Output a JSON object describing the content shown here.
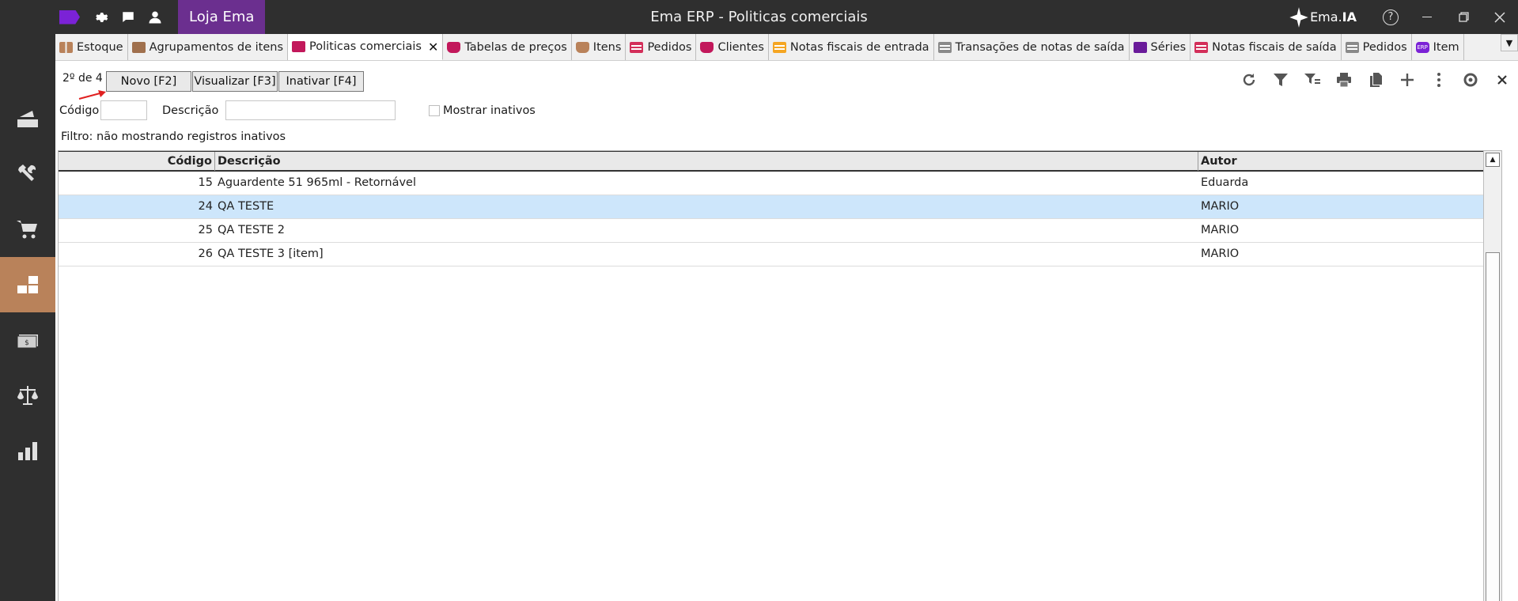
{
  "titlebar": {
    "store": "Loja Ema",
    "title": "Ema ERP - Politicas comerciais",
    "brand_prefix": "Ema.",
    "brand_suffix": "IA",
    "help": "?"
  },
  "tabs": [
    {
      "label": "Estoque",
      "icon": "blocks-icon",
      "color": "#b9825a"
    },
    {
      "label": "Agrupamentos de itens",
      "icon": "folder-icon",
      "color": "#a0704d"
    },
    {
      "label": "Politicas comerciais",
      "icon": "folder-icon",
      "color": "#c2185b",
      "active": true
    },
    {
      "label": "Tabelas de preços",
      "icon": "tray-icon",
      "color": "#c2185b"
    },
    {
      "label": "Itens",
      "icon": "tray-icon",
      "color": "#b9825a"
    },
    {
      "label": "Pedidos",
      "icon": "list-icon",
      "color": "#d32f5a"
    },
    {
      "label": "Clientes",
      "icon": "tray-icon",
      "color": "#c2185b"
    },
    {
      "label": "Notas fiscais de entrada",
      "icon": "list-icon",
      "color": "#f5a623"
    },
    {
      "label": "Transações de notas de saída",
      "icon": "list-icon",
      "color": "#8a8a8a"
    },
    {
      "label": "Séries",
      "icon": "folder-icon",
      "color": "#6a1b9a"
    },
    {
      "label": "Notas fiscais de saída",
      "icon": "list-icon",
      "color": "#d32f5a"
    },
    {
      "label": "Pedidos",
      "icon": "list-icon",
      "color": "#8a8a8a"
    },
    {
      "label": "Item",
      "icon": "erp-icon",
      "color": "#7b22d6"
    }
  ],
  "toolbar": {
    "record_count": "2º de 4",
    "new_label": "Novo [F2]",
    "view_label": "Visualizar [F3]",
    "inactivate_label": "Inativar [F4]"
  },
  "filters": {
    "code_label": "Código",
    "code_value": "",
    "description_label": "Descrição",
    "description_value": "",
    "show_inactive_label": "Mostrar inativos",
    "filter_text": "Filtro:  não mostrando registros inativos"
  },
  "grid": {
    "columns": [
      "Código",
      "Descrição",
      "Autor"
    ],
    "rows": [
      {
        "code": "15",
        "description": "Aguardente 51 965ml - Retornável",
        "author": "Eduarda"
      },
      {
        "code": "24",
        "description": "QA TESTE",
        "author": "MARIO",
        "selected": true
      },
      {
        "code": "25",
        "description": "QA TESTE 2",
        "author": "MARIO"
      },
      {
        "code": "26",
        "description": "QA TESTE 3 [item]",
        "author": "MARIO"
      }
    ]
  },
  "colors": {
    "titlebar": "#2f2f2f",
    "store_accent": "#6b2f8f",
    "logo": "#7b22d6",
    "sidebar_active": "#b9825a",
    "selected_row": "#cde6fb"
  }
}
